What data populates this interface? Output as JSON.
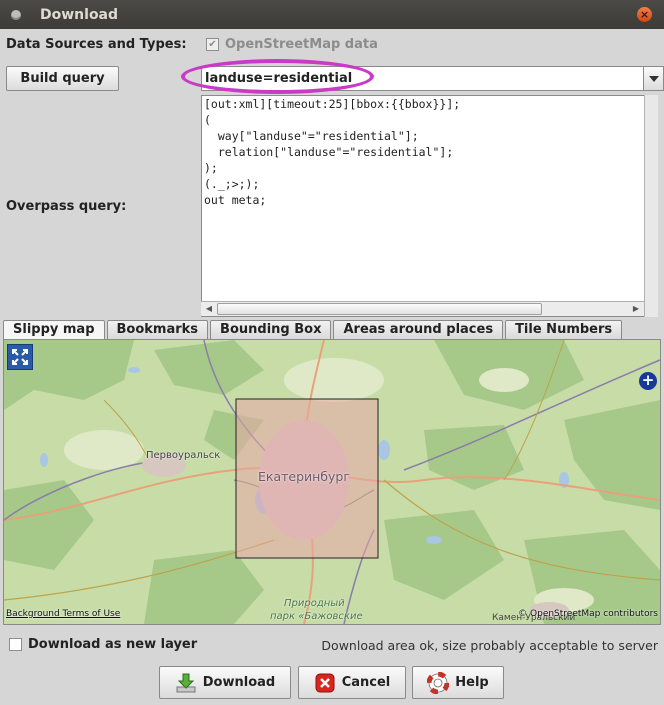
{
  "window": {
    "title": "Download",
    "close_glyph": "×"
  },
  "data_sources": {
    "label": "Data Sources and Types:",
    "option_label": "OpenStreetMap data",
    "option_checked": true,
    "check_glyph": "✔"
  },
  "query_wizard": {
    "button_label": "Build query",
    "value": "landuse=residential",
    "highlight_color": "#c93bc7"
  },
  "overpass": {
    "label": "Overpass query:",
    "text": "[out:xml][timeout:25][bbox:{{bbox}}];\n(\n  way[\"landuse\"=\"residential\"];\n  relation[\"landuse\"=\"residential\"];\n);\n(._;>;);\nout meta;"
  },
  "tabs": [
    {
      "label": "Slippy map",
      "active": true
    },
    {
      "label": "Bookmarks",
      "active": false
    },
    {
      "label": "Bounding Box",
      "active": false
    },
    {
      "label": "Areas around places",
      "active": false
    },
    {
      "label": "Tile Numbers",
      "active": false
    }
  ],
  "map": {
    "city_main": "Екатеринбург",
    "city_west": "Первоуральск",
    "park_line1": "Природный",
    "park_line2": "парк «Бажовские",
    "place_se": "Камен-Уральский",
    "background_terms": "Background Terms of Use",
    "attribution": "© OpenStreetMap contributors",
    "colors": {
      "land": "#c8dca8",
      "forest": "#a6c98a",
      "water": "#a9c6e2",
      "selection": "#e8a8a8"
    }
  },
  "new_layer": {
    "label": "Download as new layer",
    "checked": false
  },
  "status_text": "Download area ok, size probably acceptable to server",
  "buttons": {
    "download": "Download",
    "cancel": "Cancel",
    "help": "Help"
  },
  "icons": {
    "zoom": "expand-arrows-icon",
    "add": "plus-circle-icon",
    "download": "download-arrow-icon",
    "cancel": "cancel-x-icon",
    "help": "lifebuoy-icon"
  }
}
